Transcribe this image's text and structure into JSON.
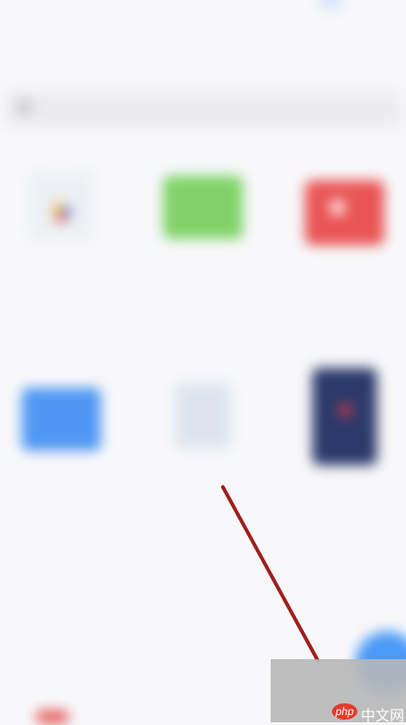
{
  "page": {
    "title": "",
    "search_placeholder": ""
  },
  "grid": {
    "items": [
      {
        "label": ""
      },
      {
        "label": ""
      },
      {
        "label": ""
      },
      {
        "label": ""
      },
      {
        "label": ""
      },
      {
        "label": ""
      }
    ]
  },
  "watermark": {
    "logo_text": "php",
    "text": "中文网"
  },
  "colors": {
    "accent_blue": "#4a9af6",
    "folder_green": "#7fd267",
    "folder_red": "#e95454",
    "arrow": "#a01e1e"
  }
}
